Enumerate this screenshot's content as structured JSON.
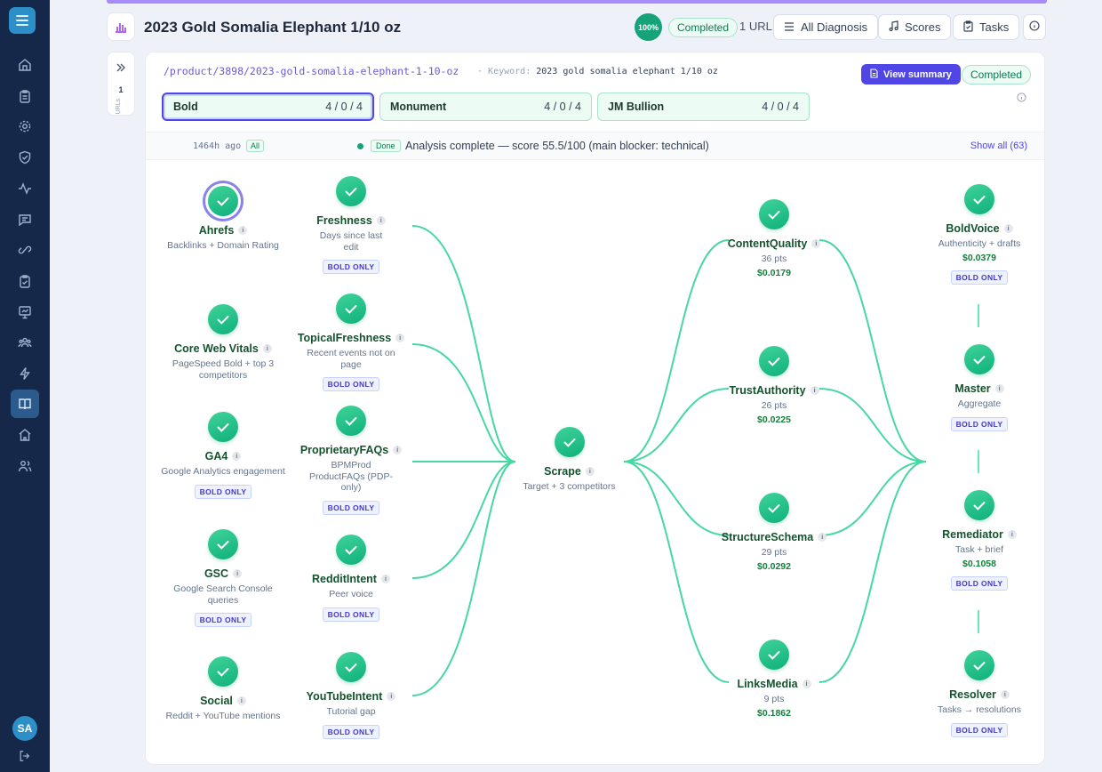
{
  "page": {
    "title": "2023 Gold Somalia Elephant 1/10 oz",
    "progress": "100%",
    "status": "Completed",
    "url_count": "1 URL"
  },
  "toolbar": {
    "diagnosis": "All Diagnosis",
    "scores": "Scores",
    "tasks": "Tasks"
  },
  "side": {
    "count": "1",
    "label": "URLs"
  },
  "detail": {
    "url": "/product/3898/2023-gold-somalia-elephant-1-10-oz",
    "keyword_label": "Keyword:",
    "keyword": "2023 gold somalia elephant 1/10 oz",
    "view_summary": "View summary",
    "status": "Completed"
  },
  "competitors": [
    {
      "name": "Bold",
      "a": "4",
      "b": "0",
      "c": "4"
    },
    {
      "name": "Monument",
      "a": "4",
      "b": "0",
      "c": "4"
    },
    {
      "name": "JM Bullion",
      "a": "4",
      "b": "0",
      "c": "4"
    }
  ],
  "status_row": {
    "ago": "1464h ago",
    "all": "All",
    "done": "Done",
    "text": "Analysis complete — score 55.5/100 (main blocker: technical)",
    "show_all": "Show all (63)"
  },
  "badge_text": "BOLD ONLY",
  "nodes": {
    "ahrefs": {
      "name": "Ahrefs",
      "desc": "Backlinks + Domain Rating"
    },
    "cwv": {
      "name": "Core Web Vitals",
      "desc": "PageSpeed Bold + top 3 competitors"
    },
    "ga4": {
      "name": "GA4",
      "desc": "Google Analytics engagement"
    },
    "gsc": {
      "name": "GSC",
      "desc": "Google Search Console queries"
    },
    "social": {
      "name": "Social",
      "desc": "Reddit + YouTube mentions"
    },
    "freshness": {
      "name": "Freshness",
      "desc": "Days since last edit"
    },
    "topical": {
      "name": "TopicalFreshness",
      "desc": "Recent events not on page"
    },
    "faqs": {
      "name": "ProprietaryFAQs",
      "desc": "BPMProd ProductFAQs (PDP-only)"
    },
    "reddit": {
      "name": "RedditIntent",
      "desc": "Peer voice"
    },
    "youtube": {
      "name": "YouTubeIntent",
      "desc": "Tutorial gap"
    },
    "scrape": {
      "name": "Scrape",
      "desc": "Target + 3 competitors"
    },
    "content": {
      "name": "ContentQuality",
      "pts": "36 pts",
      "price": "$0.0179"
    },
    "trust": {
      "name": "TrustAuthority",
      "pts": "26 pts",
      "price": "$0.0225"
    },
    "schema": {
      "name": "StructureSchema",
      "pts": "29 pts",
      "price": "$0.0292"
    },
    "links": {
      "name": "LinksMedia",
      "pts": "9 pts",
      "price": "$0.1862"
    },
    "boldvoice": {
      "name": "BoldVoice",
      "desc": "Authenticity + drafts",
      "price": "$0.0379"
    },
    "master": {
      "name": "Master",
      "desc": "Aggregate"
    },
    "remediator": {
      "name": "Remediator",
      "desc": "Task + brief",
      "price": "$0.1058"
    },
    "resolver": {
      "name": "Resolver",
      "desc": "Tasks → resolutions"
    }
  },
  "colors": {
    "sidebar": "#16284a",
    "accent": "#4f46e5",
    "success": "#16a37a",
    "edge": "#34d399"
  }
}
